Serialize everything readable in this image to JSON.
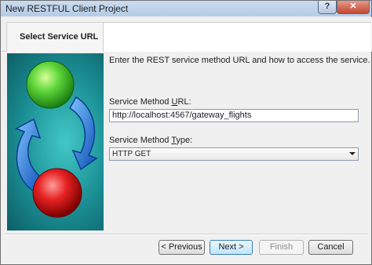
{
  "window": {
    "title": "New RESTFUL Client Project",
    "help_label": "?",
    "close_label": "✕"
  },
  "tab": {
    "label": "Select Service URL"
  },
  "content": {
    "intro": "Enter the REST service method URL and how to access the service.",
    "url_label_prefix": "Service Method ",
    "url_label_key": "U",
    "url_label_suffix": "RL:",
    "url_value": "http://localhost:4567/gateway_flights",
    "type_label_prefix": "Service Method ",
    "type_label_key": "T",
    "type_label_suffix": "ype:",
    "type_value": "HTTP GET"
  },
  "buttons": {
    "previous": "< Previous",
    "next": "Next >",
    "finish": "Finish",
    "cancel": "Cancel"
  },
  "colors": {
    "banner_teal": "#1a8e93",
    "green_ball": "#33b626",
    "red_ball": "#d11a1a",
    "arrow_blue": "#1f6fd6"
  },
  "icons": {
    "banner": "refresh-arrows-graphic"
  }
}
